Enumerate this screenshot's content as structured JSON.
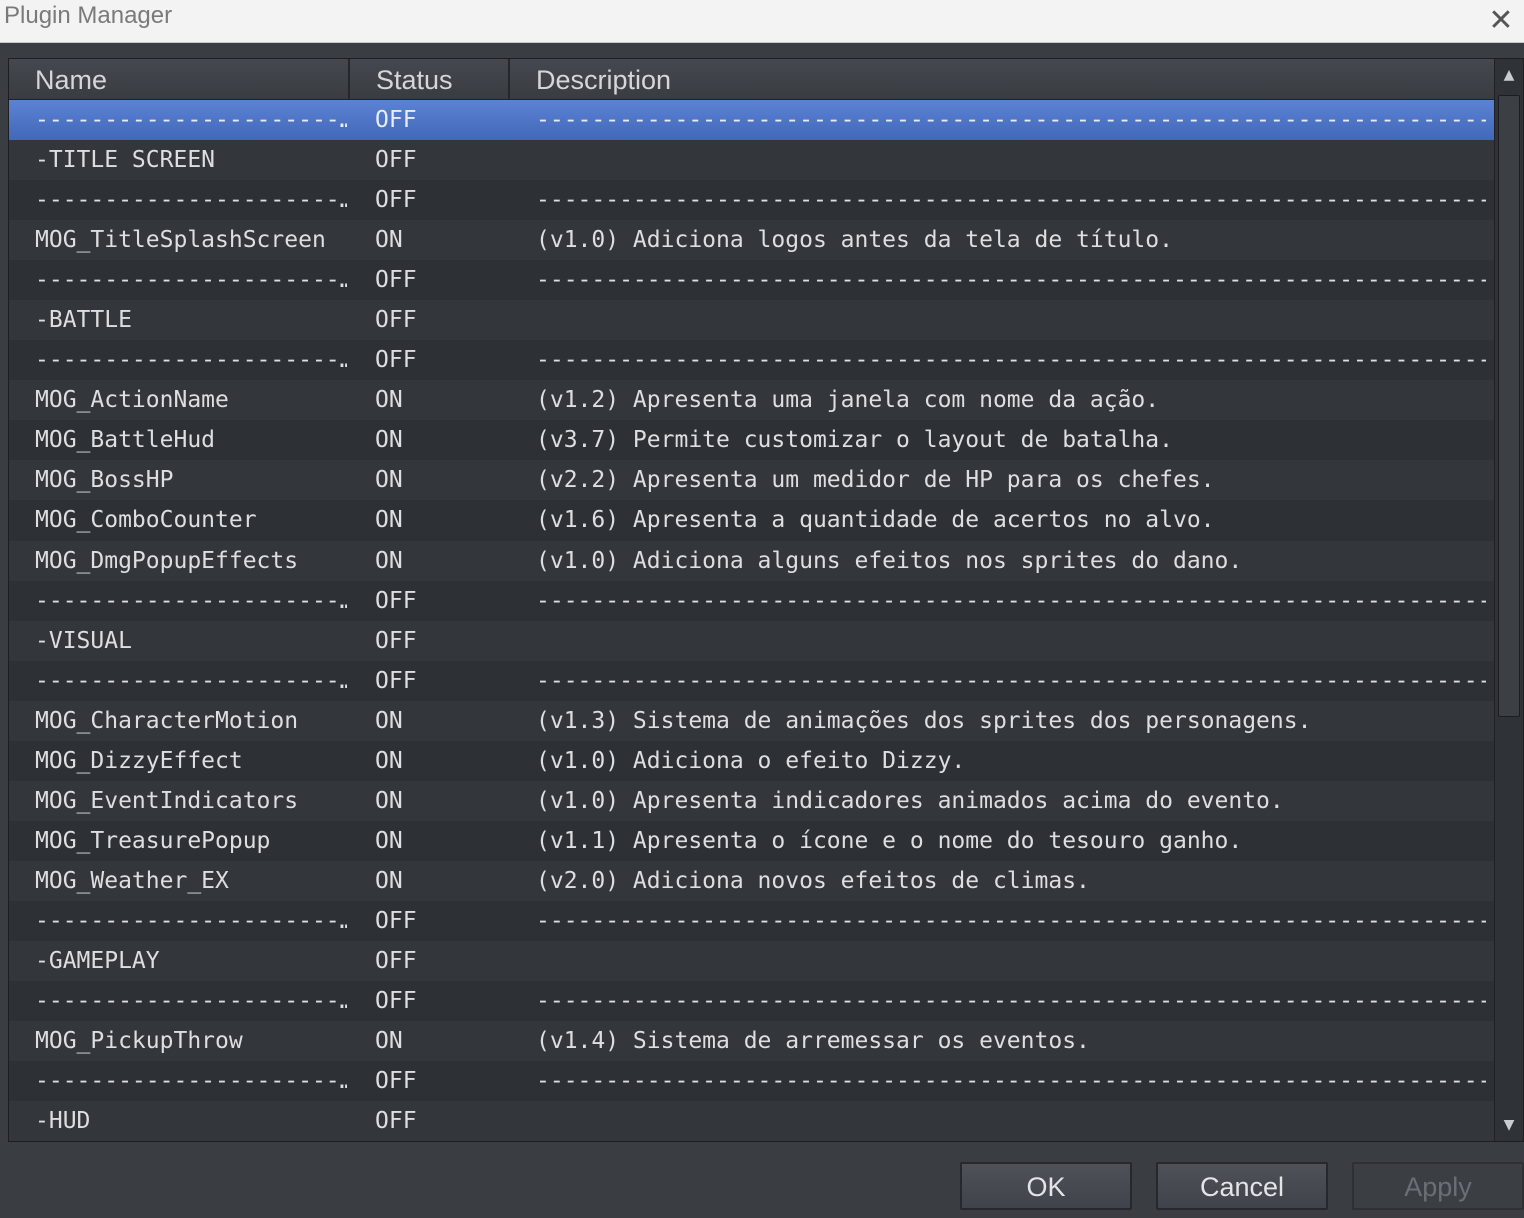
{
  "window": {
    "title": "Plugin Manager",
    "close_glyph": "✕"
  },
  "table": {
    "columns": {
      "name": "Name",
      "status": "Status",
      "description": "Description"
    },
    "rows": [
      {
        "name": "----------------------…",
        "status": "OFF",
        "description": "--------------------------------------------------------------------------…",
        "selected": true
      },
      {
        "name": "-TITLE SCREEN",
        "status": "OFF",
        "description": ""
      },
      {
        "name": "----------------------…",
        "status": "OFF",
        "description": "--------------------------------------------------------------------------…"
      },
      {
        "name": "MOG_TitleSplashScreen",
        "status": "ON",
        "description": "(v1.0) Adiciona logos antes da tela de título."
      },
      {
        "name": "----------------------…",
        "status": "OFF",
        "description": "--------------------------------------------------------------------------…"
      },
      {
        "name": "-BATTLE",
        "status": "OFF",
        "description": ""
      },
      {
        "name": "----------------------…",
        "status": "OFF",
        "description": "--------------------------------------------------------------------------…"
      },
      {
        "name": "MOG_ActionName",
        "status": "ON",
        "description": "(v1.2) Apresenta uma janela com nome da ação."
      },
      {
        "name": "MOG_BattleHud",
        "status": "ON",
        "description": "(v3.7) Permite customizar o layout de batalha."
      },
      {
        "name": "MOG_BossHP",
        "status": "ON",
        "description": "(v2.2) Apresenta um medidor de HP para os chefes."
      },
      {
        "name": "MOG_ComboCounter",
        "status": "ON",
        "description": "(v1.6) Apresenta a quantidade de acertos no alvo."
      },
      {
        "name": "MOG_DmgPopupEffects",
        "status": "ON",
        "description": "(v1.0) Adiciona alguns efeitos nos sprites do dano."
      },
      {
        "name": "----------------------…",
        "status": "OFF",
        "description": "--------------------------------------------------------------------------…"
      },
      {
        "name": "-VISUAL",
        "status": "OFF",
        "description": ""
      },
      {
        "name": "----------------------…",
        "status": "OFF",
        "description": "--------------------------------------------------------------------------…"
      },
      {
        "name": "MOG_CharacterMotion",
        "status": "ON",
        "description": "(v1.3) Sistema de animações dos sprites dos personagens."
      },
      {
        "name": "MOG_DizzyEffect",
        "status": "ON",
        "description": "(v1.0) Adiciona o efeito Dizzy."
      },
      {
        "name": "MOG_EventIndicators",
        "status": "ON",
        "description": "(v1.0) Apresenta indicadores animados acima do evento."
      },
      {
        "name": "MOG_TreasurePopup",
        "status": "ON",
        "description": "(v1.1) Apresenta o ícone e o nome do tesouro ganho."
      },
      {
        "name": "MOG_Weather_EX",
        "status": "ON",
        "description": "(v2.0) Adiciona novos efeitos de climas."
      },
      {
        "name": "----------------------…",
        "status": "OFF",
        "description": "--------------------------------------------------------------------------…"
      },
      {
        "name": "-GAMEPLAY",
        "status": "OFF",
        "description": ""
      },
      {
        "name": "----------------------…",
        "status": "OFF",
        "description": "--------------------------------------------------------------------------…"
      },
      {
        "name": "MOG_PickupThrow",
        "status": "ON",
        "description": "(v1.4) Sistema de arremessar os eventos."
      },
      {
        "name": "----------------------…",
        "status": "OFF",
        "description": "--------------------------------------------------------------------------…"
      },
      {
        "name": "-HUD",
        "status": "OFF",
        "description": ""
      }
    ]
  },
  "scrollbar": {
    "up_glyph": "▲",
    "down_glyph": "▼"
  },
  "buttons": {
    "ok": "OK",
    "cancel": "Cancel",
    "apply": "Apply"
  },
  "colors": {
    "selection": "#4f78c9",
    "background": "#3a3d42",
    "row_text": "#dcdee1"
  }
}
